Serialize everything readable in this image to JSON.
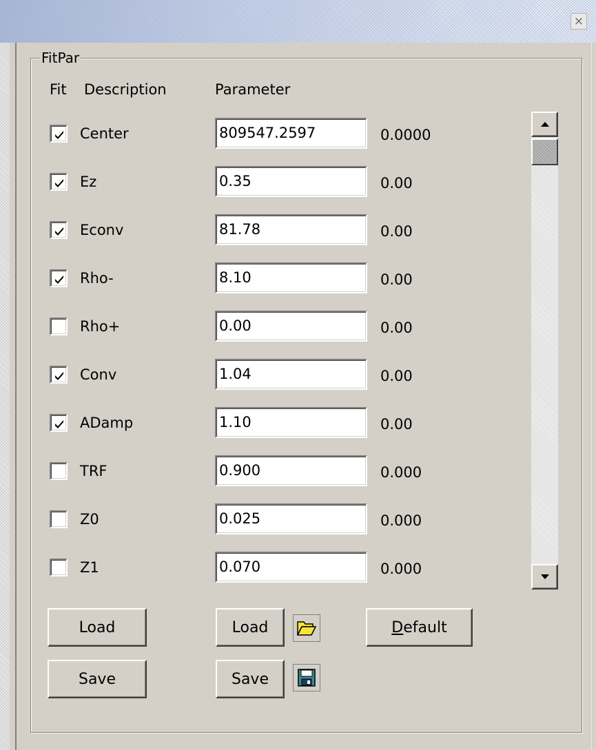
{
  "window": {
    "close_glyph": "×"
  },
  "group": {
    "title": "FitPar"
  },
  "headers": {
    "fit": "Fit",
    "description": "Description",
    "parameter": "Parameter"
  },
  "rows": [
    {
      "checked": true,
      "description": "Center",
      "value": "809547.2597",
      "error": "0.0000"
    },
    {
      "checked": true,
      "description": "Ez",
      "value": "0.35",
      "error": "0.00"
    },
    {
      "checked": true,
      "description": "Econv",
      "value": "81.78",
      "error": "0.00"
    },
    {
      "checked": true,
      "description": "Rho-",
      "value": "8.10",
      "error": "0.00"
    },
    {
      "checked": false,
      "description": "Rho+",
      "value": "0.00",
      "error": "0.00"
    },
    {
      "checked": true,
      "description": "Conv",
      "value": "1.04",
      "error": "0.00"
    },
    {
      "checked": true,
      "description": "ADamp",
      "value": "1.10",
      "error": "0.00"
    },
    {
      "checked": false,
      "description": "TRF",
      "value": "0.900",
      "error": "0.000"
    },
    {
      "checked": false,
      "description": "Z0",
      "value": "0.025",
      "error": "0.000"
    },
    {
      "checked": false,
      "description": "Z1",
      "value": "0.070",
      "error": "0.000"
    }
  ],
  "buttons": {
    "fit_load": "Load",
    "fit_save": "Save",
    "param_load": "Load",
    "param_save": "Save",
    "default_mnemonic": "D",
    "default_rest": "efault"
  },
  "icons": {
    "open_folder": "open-folder-icon",
    "save_disk": "floppy-disk-icon",
    "scroll_up": "scroll-up-arrow-icon",
    "scroll_down": "scroll-down-arrow-icon",
    "checkmark": "checkmark-icon"
  },
  "scrollbar": {
    "position_fraction": 0.0
  },
  "colors": {
    "face": "#d4d0c8",
    "field_bg": "#ffffff",
    "folder_yellow": "#f6e23a",
    "disk_teal": "#3a8a98"
  }
}
